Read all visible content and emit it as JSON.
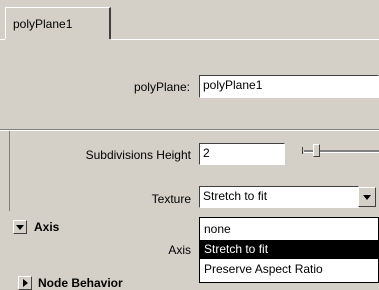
{
  "tab": {
    "label": "polyPlane1"
  },
  "node_row": {
    "label": "polyPlane:",
    "value": "polyPlane1"
  },
  "subdivisions": {
    "label": "Subdivisions Height",
    "value": "2"
  },
  "texture": {
    "label": "Texture",
    "value": "Stretch to fit"
  },
  "sections": [
    {
      "label": "Axis",
      "expanded": true
    },
    {
      "label": "Node Behavior",
      "expanded": false
    }
  ],
  "axis_row": {
    "label": "Axis"
  },
  "dropdown": {
    "options": [
      "none",
      "Stretch to fit",
      "Preserve Aspect Ratio"
    ],
    "selected_index": 1
  },
  "colors": {
    "background": "#d4d0c8",
    "selection": "#000000"
  }
}
